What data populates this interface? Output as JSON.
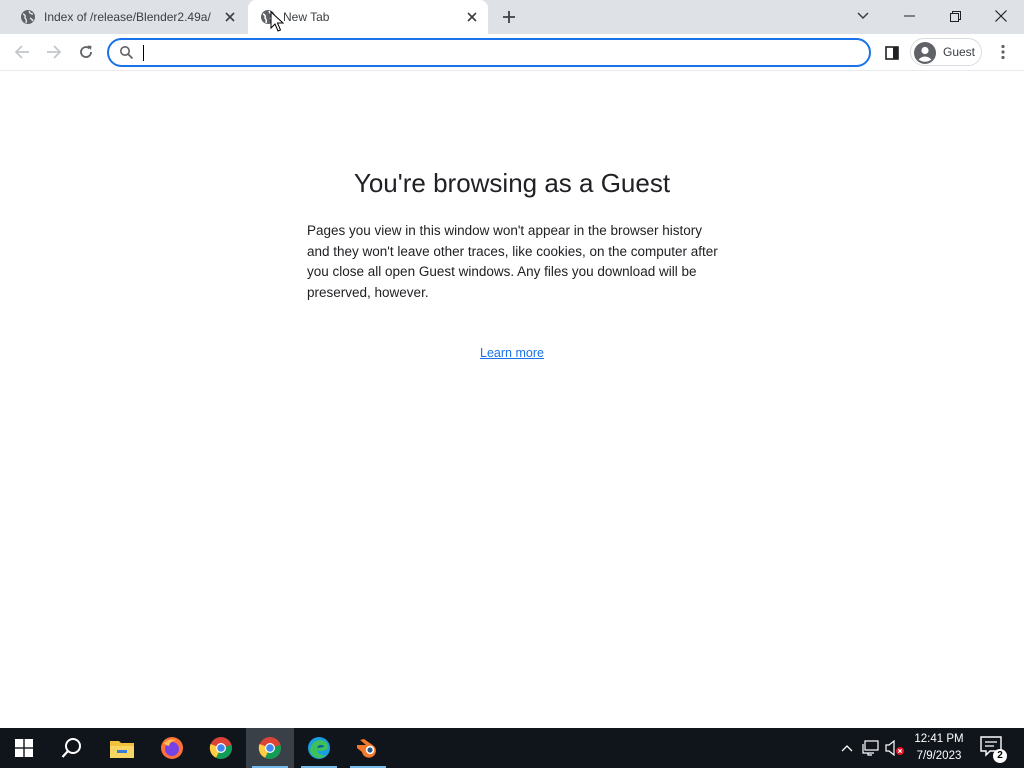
{
  "tabs": [
    {
      "title": "Index of /release/Blender2.49a/",
      "icon": "globe-icon",
      "active": false
    },
    {
      "title": "New Tab",
      "icon": "globe-icon",
      "active": true
    }
  ],
  "toolbar": {
    "omnibox_value": "",
    "profile_label": "Guest"
  },
  "content": {
    "heading": "You're browsing as a Guest",
    "body": "Pages you view in this window won't appear in the browser history and they won't leave other traces, like cookies, on the computer after you close all open Guest windows. Any files you download will be preserved, however.",
    "learn_more": "Learn more"
  },
  "taskbar": {
    "apps": [
      "start-icon",
      "search-icon",
      "file-explorer-icon",
      "firefox-icon",
      "chrome-icon",
      "chrome-icon",
      "edge-icon",
      "blender-icon"
    ],
    "time": "12:41 PM",
    "date": "7/9/2023",
    "notification_count": "2"
  },
  "colors": {
    "accent": "#1a73e8",
    "tabstrip": "#dee1e6",
    "taskbar": "#10151c"
  }
}
